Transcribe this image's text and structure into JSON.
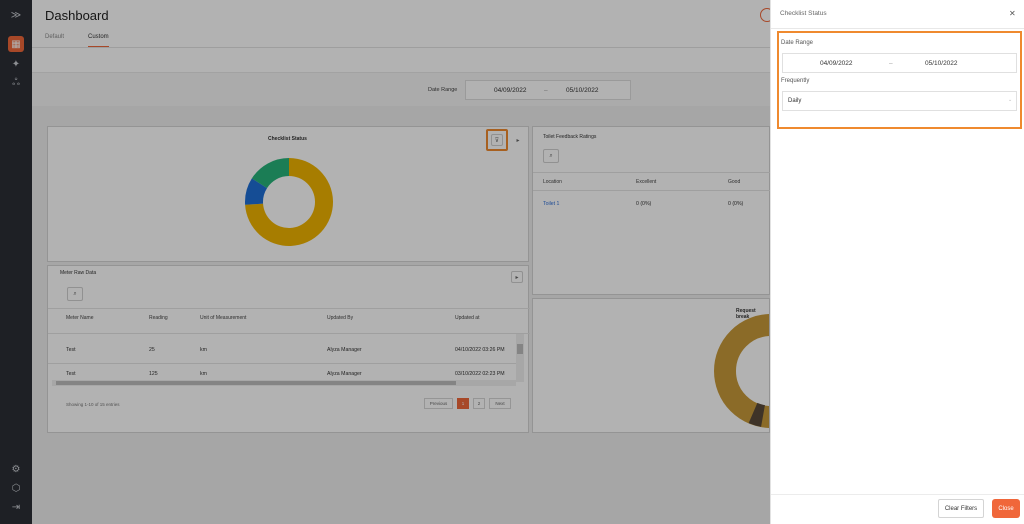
{
  "header": {
    "title": "Dashboard"
  },
  "tabs": [
    {
      "label": "Default"
    },
    {
      "label": "Custom"
    }
  ],
  "filter_bar": {
    "label": "Date Range",
    "from": "04/09/2022",
    "separator": "–",
    "to": "05/10/2022"
  },
  "checklist_card": {
    "title": "Checklist Status",
    "filter_icon": "filter-icon",
    "chart_data": {
      "type": "pie",
      "values": [
        0.74,
        0.1,
        0.16
      ],
      "colors": [
        "#f0b400",
        "#1f6fd6",
        "#27b37a"
      ]
    }
  },
  "toilet_card": {
    "title": "Toilet Feedback Ratings",
    "search_icon": "search-icon",
    "columns": [
      "Location",
      "Excellent",
      "Good"
    ],
    "rows": [
      {
        "location": "Toilet 1",
        "excellent": "0 (0%)",
        "good": "0 (0%)"
      }
    ]
  },
  "meter_card": {
    "title": "Meter Raw Data",
    "columns": [
      "Meter Name",
      "Reading",
      "Unit of Measurement",
      "Updated By",
      "Updated at"
    ],
    "rows": [
      {
        "meter": "Test",
        "reading": "25",
        "unit": "km",
        "by": "Alyza Manager",
        "at": "04/10/2022 03:26 PM"
      },
      {
        "meter": "Test",
        "reading": "125",
        "unit": "km",
        "by": "Alyza Manager",
        "at": "03/10/2022 02:23 PM"
      }
    ],
    "info": "Showing 1-10 of 15 entries",
    "pager": {
      "previous": "Previous",
      "page1": "1",
      "page2": "2",
      "next": "Next"
    }
  },
  "request_card": {
    "title": "Request break",
    "colors": [
      "#c89a3a",
      "#5a4a3a",
      "#39a9b8"
    ]
  },
  "panel": {
    "title": "Checklist Status",
    "date_label": "Date Range",
    "from": "04/09/2022",
    "separator": "–",
    "to": "05/10/2022",
    "freq_label": "Frequently",
    "freq_value": "Daily",
    "clear_label": "Clear Filters",
    "close_label": "Close"
  }
}
